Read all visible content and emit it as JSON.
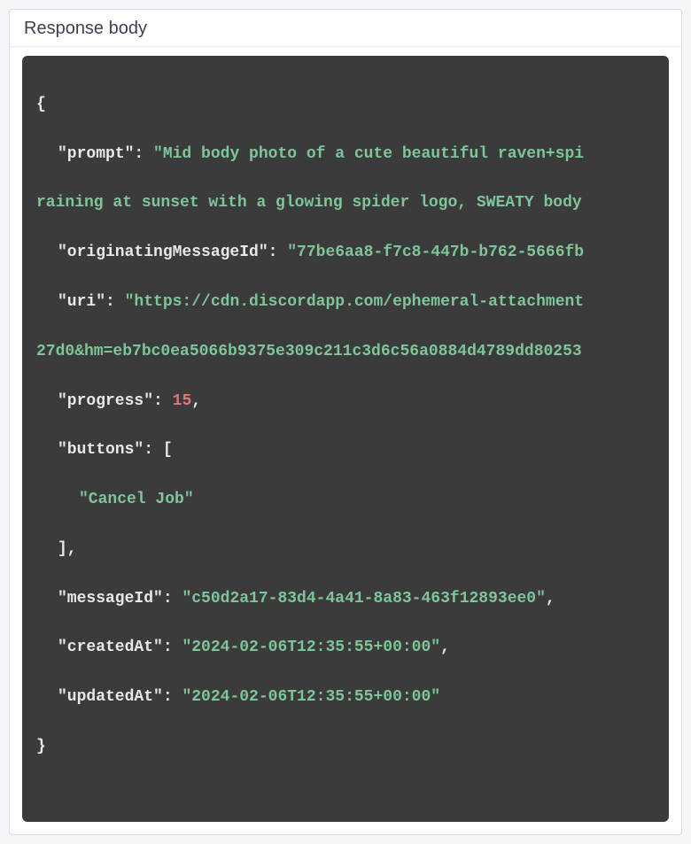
{
  "header": {
    "title": "Response body"
  },
  "json": {
    "keys": {
      "prompt": "\"prompt\"",
      "originatingMessageId": "\"originatingMessageId\"",
      "uri": "\"uri\"",
      "progress": "\"progress\"",
      "buttons": "\"buttons\"",
      "messageId": "\"messageId\"",
      "createdAt": "\"createdAt\"",
      "updatedAt": "\"updatedAt\""
    },
    "values": {
      "prompt_line1": "\"Mid body photo of a cute beautiful raven+spi",
      "prompt_line2": "raining at sunset with a glowing spider logo, SWEATY body",
      "originatingMessageId": "\"77be6aa8-f7c8-447b-b762-5666fb",
      "uri_line1": "\"https://cdn.discordapp.com/ephemeral-attachment",
      "uri_line2": "27d0&hm=eb7bc0ea5066b9375e309c211c3d6c56a0884d4789dd80253",
      "progress": "15",
      "buttons_item": "\"Cancel Job\"",
      "messageId": "\"c50d2a17-83d4-4a41-8a83-463f12893ee0\"",
      "createdAt": "\"2024-02-06T12:35:55+00:00\"",
      "updatedAt": "\"2024-02-06T12:35:55+00:00\""
    },
    "punct": {
      "open_brace": "{",
      "close_brace": "}",
      "colon_sp": ": ",
      "comma": ",",
      "open_bracket": "[",
      "close_bracket_comma": "],"
    }
  }
}
